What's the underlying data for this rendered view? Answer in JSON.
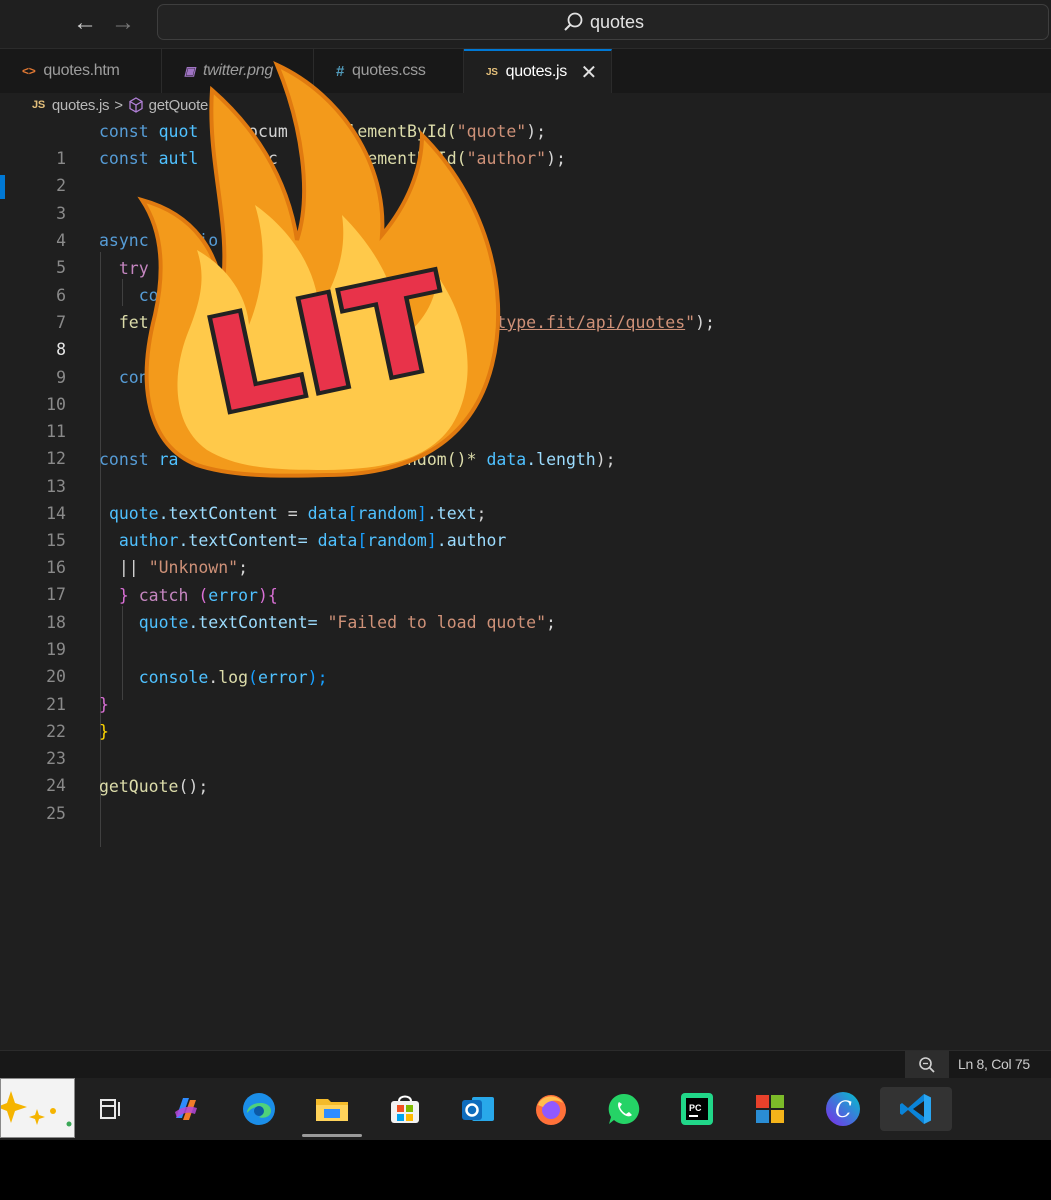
{
  "titlebar": {
    "search_text": "quotes"
  },
  "tabs": [
    {
      "label": "quotes.htm",
      "icon": "html-icon",
      "active": false
    },
    {
      "label": "twitter.png",
      "icon": "image-icon",
      "active": false
    },
    {
      "label": "quotes.css",
      "icon": "css-icon",
      "active": false
    },
    {
      "label": "quotes.js",
      "icon": "js-icon",
      "active": true
    }
  ],
  "breadcrumb": {
    "file": "quotes.js",
    "symbol": "getQuote",
    "sep": ">"
  },
  "editor": {
    "current_line": 8,
    "lines": [
      {
        "n": "1"
      },
      {
        "n": "2"
      },
      {
        "n": "3"
      },
      {
        "n": "4"
      },
      {
        "n": "5"
      },
      {
        "n": "6"
      },
      {
        "n": "7"
      },
      {
        "n": "8"
      },
      {
        "n": "9"
      },
      {
        "n": "10"
      },
      {
        "n": "11"
      },
      {
        "n": "12"
      },
      {
        "n": "13"
      },
      {
        "n": "14"
      },
      {
        "n": "15"
      },
      {
        "n": "16"
      },
      {
        "n": "17"
      },
      {
        "n": "18"
      },
      {
        "n": "19"
      },
      {
        "n": "20"
      },
      {
        "n": "21"
      },
      {
        "n": "22"
      },
      {
        "n": "23"
      },
      {
        "n": "24"
      },
      {
        "n": "25"
      }
    ],
    "code": {
      "l1": [
        "const",
        "quot",
        "= docum",
        "etElementById(",
        "\"quote\"",
        ");"
      ],
      "l2": [
        "const",
        "autl",
        "= doc",
        "getElementById(",
        "\"author\"",
        ");"
      ],
      "l5": [
        "async",
        "nctio"
      ],
      "l6": [
        "try"
      ],
      "l7": [
        "co"
      ],
      "l8": [
        "fet",
        "aw?url=https://type.fit/api/quotes",
        "\"",
        ");"
      ],
      "l10": [
        "con",
        ";"
      ],
      "l13": [
        "const",
        "ra",
        ".random()*",
        "data",
        ".length",
        ");"
      ],
      "l15": [
        "quote",
        ".textContent",
        "=",
        "data",
        "[",
        "random",
        "]",
        ".text",
        ";"
      ],
      "l16": [
        "author",
        ".textContent=",
        "data",
        "[",
        "random",
        "]",
        ".author"
      ],
      "l17": [
        "||",
        "\"Unknown\"",
        ";"
      ],
      "l18": [
        "}",
        "catch",
        "(",
        "error",
        "){"
      ],
      "l19": [
        "quote",
        ".textContent=",
        "\"Failed to load quote\"",
        ";"
      ],
      "l21": [
        "console",
        ".",
        "log",
        "(",
        "error",
        ");"
      ],
      "l22": [
        "}"
      ],
      "l23": [
        "}"
      ],
      "l25": [
        "getQuote",
        "();"
      ]
    }
  },
  "sticker": {
    "text": "LIT"
  },
  "statusbar": {
    "position": "Ln 8, Col 75"
  },
  "taskbar": {
    "apps": [
      "widgets-icon",
      "task-view-icon",
      "copilot-icon",
      "edge-icon",
      "file-explorer-icon",
      "store-icon",
      "outlook-icon",
      "firefox-icon",
      "whatsapp-icon",
      "pycharm-icon",
      "office-icon",
      "canva-icon",
      "vscode-icon"
    ]
  }
}
